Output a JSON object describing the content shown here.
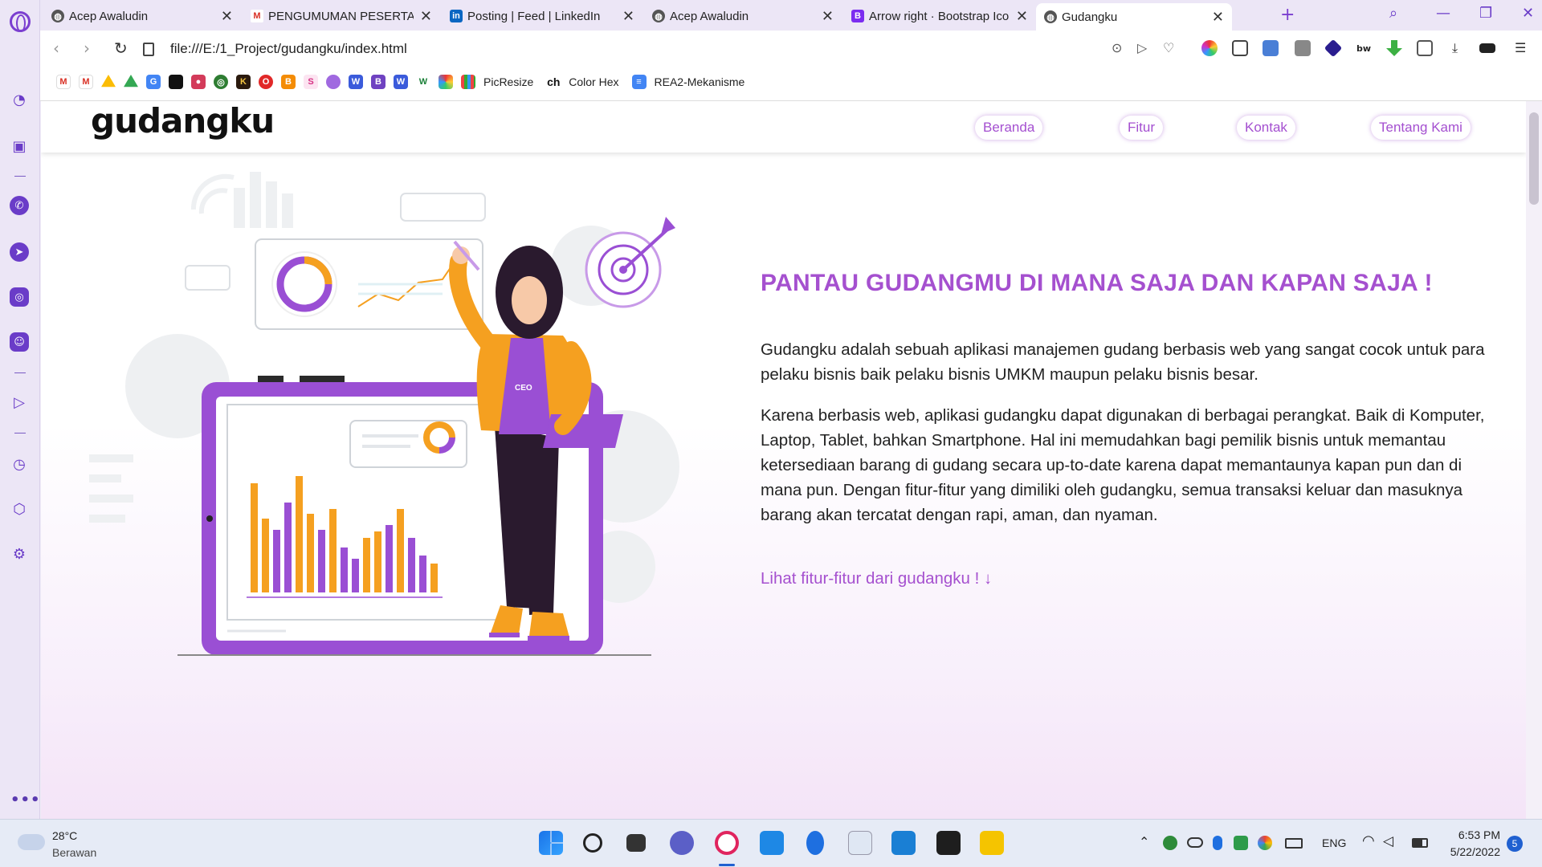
{
  "browser": {
    "tabs": [
      {
        "title": "Acep Awaludin",
        "favicon": "globe-icon"
      },
      {
        "title": "PENGUMUMAN PESERTA P",
        "favicon": "gmail-icon"
      },
      {
        "title": "Posting | Feed | LinkedIn",
        "favicon": "linkedin-icon"
      },
      {
        "title": "Acep Awaludin",
        "favicon": "globe-icon"
      },
      {
        "title": "Arrow right · Bootstrap Icon",
        "favicon": "bootstrap-icon"
      },
      {
        "title": "Gudangku",
        "favicon": "globe-icon",
        "active": true
      }
    ],
    "url": "file:///E:/1_Project/gudangku/index.html",
    "bookmarks": [
      {
        "label": "PicResize"
      },
      {
        "label": "Color Hex",
        "icon_text": "ch"
      },
      {
        "label": "REA2-Mekanisme"
      }
    ]
  },
  "site": {
    "brand": "gudangku",
    "menu": [
      "Beranda",
      "Fitur",
      "Kontak",
      "Tentang Kami"
    ],
    "hero": {
      "title": "PANTAU GUDANGMU DI MANA SAJA DAN KAPAN SAJA !",
      "paragraph1": "Gudangku adalah sebuah aplikasi manajemen gudang berbasis web yang sangat cocok untuk para pelaku bisnis baik pelaku bisnis UMKM maupun pelaku bisnis besar.",
      "paragraph2": "Karena berbasis web, aplikasi gudangku dapat digunakan di berbagai perangkat. Baik di Komputer, Laptop, Tablet, bahkan Smartphone. Hal ini memudahkan bagi pemilik bisnis untuk memantau ketersediaan barang di gudang secara up-to-date karena dapat memantaunya kapan pun dan di mana pun. Dengan fitur-fitur yang dimiliki oleh gudangku, semua transaksi keluar dan masuknya barang akan tercatat dengan rapi, aman, dan nyaman.",
      "link": "Lihat fitur-fitur dari gudangku ! ↓",
      "badge": "CEO"
    },
    "colors": {
      "accent": "#a550cf",
      "purple": "#9a4fd4",
      "orange": "#f5a020"
    }
  },
  "taskbar": {
    "weather_temp": "28°C",
    "weather_desc": "Berawan",
    "lang": "ENG",
    "time": "6:53 PM",
    "date": "5/22/2022",
    "notif_count": "5"
  }
}
